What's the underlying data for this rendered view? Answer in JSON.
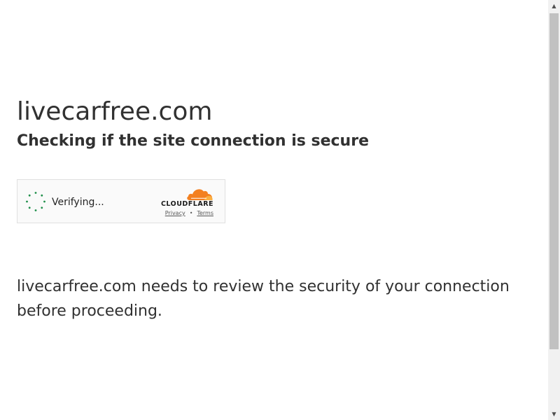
{
  "page": {
    "site_title": "livecarfree.com",
    "subtitle": "Checking if the site connection is secure",
    "body_text": "livecarfree.com needs to review the security of your connection before proceeding."
  },
  "turnstile": {
    "status_text": "Verifying...",
    "brand_text": "CLOUDFLARE",
    "privacy_link": "Privacy",
    "separator": "•",
    "terms_link": "Terms",
    "spinner_icon": "spinner-icon",
    "logo_icon": "cloudflare-cloud-icon",
    "brand_color": "#f38020",
    "spinner_color": "#1f8f4a"
  },
  "scrollbar": {
    "up_arrow": "▲",
    "down_arrow": "▼"
  }
}
